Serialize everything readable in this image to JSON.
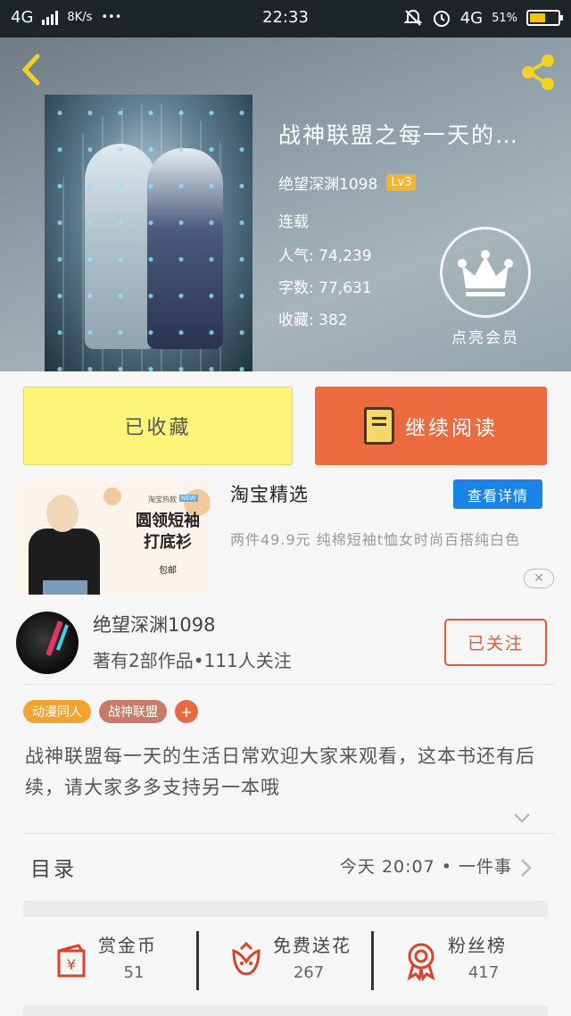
{
  "status_bar": {
    "network_left": "4G",
    "speed": "8K/s",
    "dots": "•••",
    "time": "22:33",
    "network_right": "4G",
    "battery_percent": "51%",
    "battery_level": 0.51
  },
  "header": {
    "book_title": "战神联盟之每一天的…",
    "author": "绝望深渊1098",
    "level_badge": "Lv3",
    "status": "连载",
    "popularity": "人气: 74,239",
    "word_count": "字数: 77,631",
    "favorites": "收藏: 382",
    "vip_label": "点亮会员"
  },
  "actions": {
    "collected_label": "已收藏",
    "continue_label": "继续阅读"
  },
  "ad": {
    "title": "淘宝精选",
    "detail_button": "查看详情",
    "description": "两件49.9元 纯棉短袖t恤女时尚百搭纯白色",
    "close": "✕",
    "image_shop": "淘宝热款",
    "image_tag": "NEW",
    "image_headline": "圆领短袖打底衫",
    "image_free": "包邮"
  },
  "author_card": {
    "name": "绝望深渊1098",
    "stats": "著有2部作品•111人关注",
    "follow_button": "已关注"
  },
  "tags": [
    {
      "label": "动漫同人",
      "color": "#f2a431"
    },
    {
      "label": "战神联盟",
      "color": "#c97b6a"
    }
  ],
  "tag_add": "+",
  "synopsis": "战神联盟每一天的生活日常欢迎大家来观看，这本书还有后续，请大家多多支持另一本哦",
  "toc": {
    "label": "目录",
    "latest": "今天 20:07 • 一件事"
  },
  "stats": [
    {
      "name": "赏金币",
      "count": "51"
    },
    {
      "name": "免费送花",
      "count": "267"
    },
    {
      "name": "粉丝榜",
      "count": "417"
    }
  ],
  "colors": {
    "accent": "#eb6a3e",
    "collected_bg": "#fdf47a",
    "ad_button": "#1a84e6",
    "stat_icon": "#d9432b"
  }
}
